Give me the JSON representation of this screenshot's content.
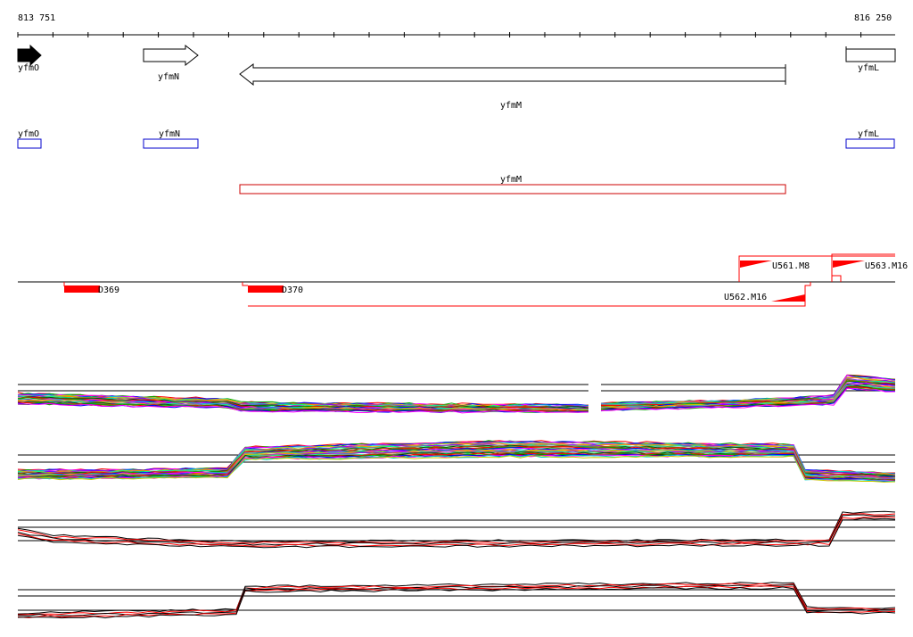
{
  "ruler": {
    "start_label": "813 751",
    "end_label": "816 250"
  },
  "genes": [
    {
      "id": "yfmO",
      "label": "yfmO",
      "strand": "+",
      "filled": true
    },
    {
      "id": "yfmN",
      "label": "yfmN",
      "strand": "+",
      "filled": false
    },
    {
      "id": "yfmM",
      "label": "yfmM",
      "strand": "-",
      "filled": false
    },
    {
      "id": "yfmL",
      "label": "yfmL",
      "strand": "+",
      "filled": false
    }
  ],
  "gene_boxes": [
    {
      "id": "yfmO",
      "label": "yfmO",
      "color": "#0000cc"
    },
    {
      "id": "yfmN",
      "label": "yfmN",
      "color": "#0000cc"
    },
    {
      "id": "yfmL",
      "label": "yfmL",
      "color": "#0000cc"
    },
    {
      "id": "yfmM",
      "label": "yfmM",
      "color": "#cc0000"
    }
  ],
  "features": [
    {
      "id": "D369",
      "label": "D369"
    },
    {
      "id": "D370",
      "label": "D370"
    },
    {
      "id": "U561.M8",
      "label": "U561.M8"
    },
    {
      "id": "U562.M16",
      "label": "U562.M16"
    },
    {
      "id": "U563.M16",
      "label": "U563.M16"
    }
  ],
  "colors": {
    "axis": "#000000",
    "feature": "#ff0000",
    "blue_box": "#0000cc",
    "red_box": "#cc0000",
    "profile_palette": [
      "#ff0000",
      "#00aa00",
      "#0000ff",
      "#ff00ff",
      "#00cccc",
      "#cccc00",
      "#ff8800",
      "#8800ff",
      "#00ff88",
      "#888888",
      "#005500",
      "#aa5500"
    ]
  }
}
